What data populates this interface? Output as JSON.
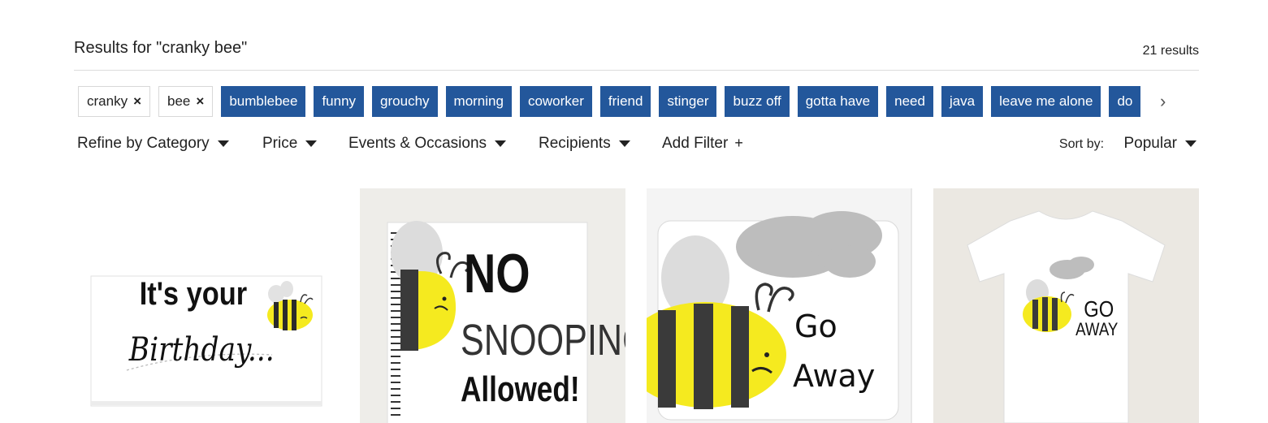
{
  "search": {
    "results_title": "Results for \"cranky bee\"",
    "results_count": "21 results"
  },
  "tags": {
    "selected": [
      {
        "label": "cranky",
        "remove": "×"
      },
      {
        "label": "bee",
        "remove": "×"
      }
    ],
    "suggested": [
      "bumblebee",
      "funny",
      "grouchy",
      "morning",
      "coworker",
      "friend",
      "stinger",
      "buzz off",
      "gotta have",
      "need",
      "java",
      "leave me alone",
      "do"
    ],
    "next_arrow": "›"
  },
  "filters": {
    "category": "Refine by Category",
    "price": "Price",
    "events": "Events & Occasions",
    "recipients": "Recipients",
    "add_filter": "Add Filter",
    "add_symbol": "+"
  },
  "sort": {
    "label": "Sort by:",
    "value": "Popular"
  },
  "products": [
    {
      "name": "birthday-card",
      "lines": [
        "It's your",
        "Birthday..."
      ]
    },
    {
      "name": "notebook",
      "lines": [
        "NO",
        "SNOOPING",
        "Allowed!"
      ]
    },
    {
      "name": "mousepad",
      "lines": [
        "Go",
        "Away"
      ]
    },
    {
      "name": "t-shirt",
      "lines": [
        "GO",
        "AWAY"
      ]
    }
  ],
  "colors": {
    "tag_blue": "#23579b",
    "bee_yellow": "#f5ea1f",
    "bee_stripe": "#3a3a3a",
    "cloud_gray": "#b8b8b8"
  }
}
